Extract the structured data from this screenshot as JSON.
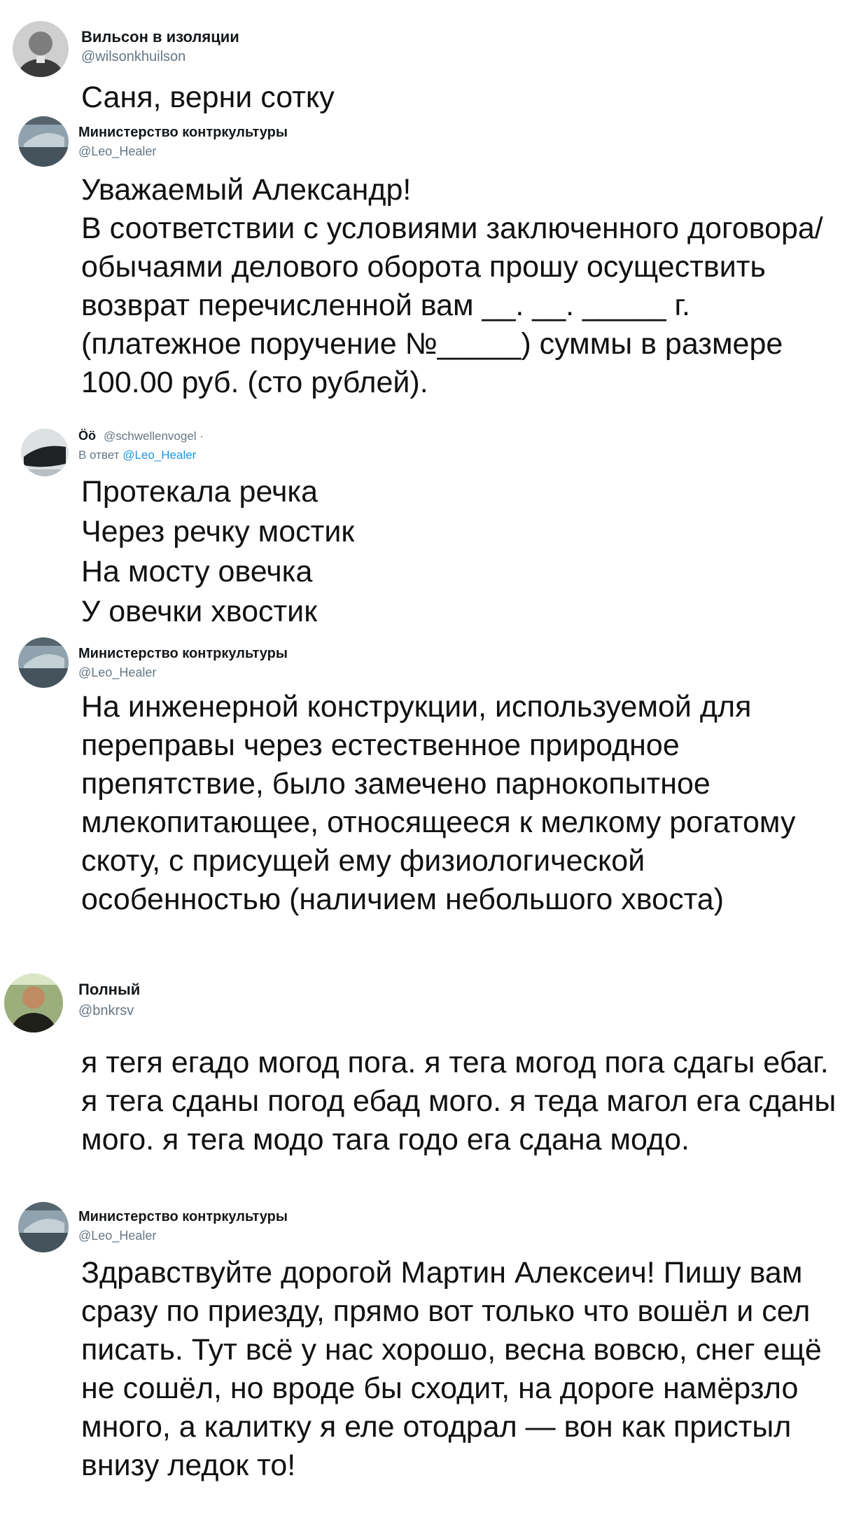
{
  "tweets": [
    {
      "name": "Вильсон в изоляции",
      "handle": "@wilsonkhuilson",
      "avatar": "avatar-man-bw",
      "text": "Саня, верни сотку"
    },
    {
      "name": "Министерство контркультуры",
      "handle": "@Leo_Healer",
      "avatar": "avatar-car-window",
      "text": "Уважаемый Александр!\nВ соответствии с условиями заключенного договора/обычаями делового оборота прошу осуществить возврат перечисленной вам __. __. _____ г. (платежное поручение №_____) суммы в размере 100.00 руб. (сто рублей)."
    },
    {
      "name": "Öö",
      "handle": "@schwellenvogel ·",
      "reply_prefix": "В ответ",
      "reply_to": "@Leo_Healer",
      "avatar": "avatar-dark-object",
      "text": "Протекала речка\nЧерез речку мостик\nНа мосту овечка\nУ овечки хвостик"
    },
    {
      "name": "Министерство контркультуры",
      "handle": "@Leo_Healer",
      "avatar": "avatar-car-window",
      "text": "На инженерной конструкции, используемой для переправы через естественное природное препятствие, было замечено парнокопытное млекопитающее, относящееся к мелкому рогатому скоту, с присущей ему физиологической особенностью (наличием небольшого хвоста)"
    },
    {
      "name": "Полный",
      "handle": "@bnkrsv",
      "avatar": "avatar-man-color",
      "text": "я тегя егадо могод пога. я тега могод пога сдагы ебаг. я тега сданы погод ебад мого. я теда магол ега сданы мого. я тега модо тага годо ега сдана модо."
    },
    {
      "name": "Министерство контркультуры",
      "handle": "@Leo_Healer",
      "avatar": "avatar-car-window",
      "text": "Здравствуйте дорогой Мартин Алексеич! Пишу вам сразу по приезду, прямо вот только что вошёл и сел писать. Тут всё у нас хорошо, весна вовсю, снег ещё не сошёл, но вроде бы сходит, на дороге намёрзло много, а калитку я еле отодрал — вон как пристыл внизу ледок то!"
    }
  ]
}
